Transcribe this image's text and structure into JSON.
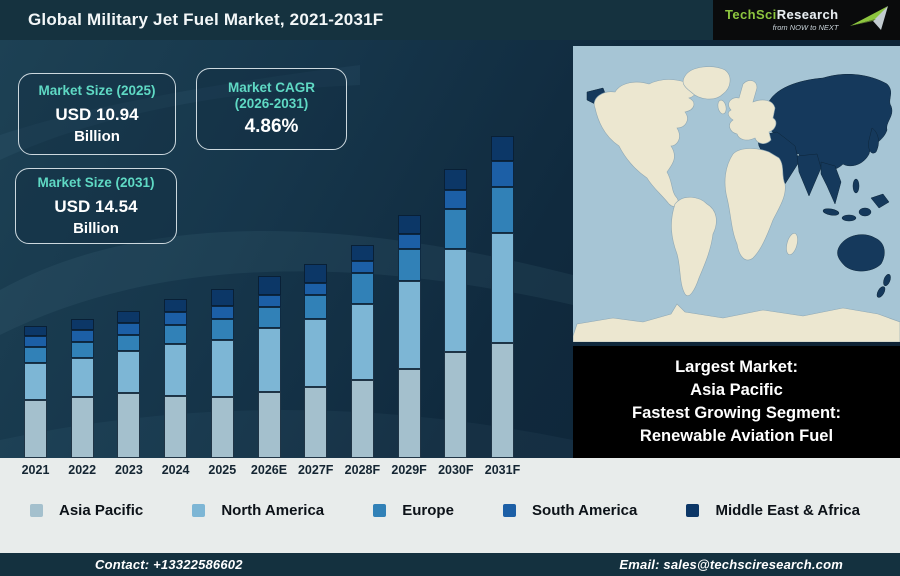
{
  "header": {
    "title": "Global Military Jet Fuel Market, 2021-2031F"
  },
  "logo": {
    "brand_primary": "TechSci",
    "brand_secondary": "Research",
    "tagline": "from NOW to NEXT"
  },
  "stats": [
    {
      "label": "Market Size (2025)",
      "label2": "",
      "value": "USD 10.94",
      "unit": "Billion"
    },
    {
      "label": "Market CAGR",
      "label2": "(2026-2031)",
      "value": "4.86%",
      "unit": ""
    },
    {
      "label": "Market Size (2031)",
      "label2": "",
      "value": "USD 14.54",
      "unit": "Billion"
    }
  ],
  "info_box": {
    "lines": [
      "Largest Market:",
      "Asia Pacific",
      "Fastest Growing Segment:",
      "Renewable Aviation Fuel"
    ]
  },
  "chart_data": {
    "type": "bar",
    "stacked": true,
    "title": "Global Military Jet Fuel Market, 2021-2031F",
    "xlabel": "",
    "ylabel": "",
    "axis_shown": false,
    "legend_position": "bottom",
    "unit_note": "relative bar heights (infographic shows no y-axis); market size labels: USD 10.94B in 2025, USD 14.54B in 2031, CAGR 4.86% (2026-2031)",
    "categories": [
      "2021",
      "2022",
      "2023",
      "2024",
      "2025",
      "2026E",
      "2027F",
      "2028F",
      "2029F",
      "2030F",
      "2031F"
    ],
    "series": [
      {
        "name": "Asia Pacific",
        "color": "#a4c0cd",
        "values": [
          58,
          61,
          65,
          62,
          61,
          66,
          71,
          78,
          89,
          106,
          115
        ]
      },
      {
        "name": "North America",
        "color": "#7db6d5",
        "values": [
          37,
          39,
          42,
          52,
          57,
          64,
          68,
          76,
          88,
          103,
          110
        ]
      },
      {
        "name": "Europe",
        "color": "#3181b7",
        "values": [
          16,
          16,
          16,
          19,
          21,
          21,
          24,
          31,
          32,
          40,
          46
        ]
      },
      {
        "name": "South America",
        "color": "#1c5fa6",
        "values": [
          11,
          12,
          12,
          13,
          13,
          12,
          12,
          12,
          15,
          19,
          26
        ]
      },
      {
        "name": "Middle East & Africa",
        "color": "#0c3767",
        "values": [
          10,
          11,
          12,
          13,
          17,
          19,
          19,
          16,
          19,
          21,
          25
        ]
      }
    ]
  },
  "map": {
    "highlighted_region": "Asia Pacific"
  },
  "footer": {
    "contact": "Contact: +13322586602",
    "email": "Email: sales@techsciresearch.com"
  },
  "colors": {
    "header_bg": "#15323f",
    "footer_bg": "#14313f",
    "strip_bg": "#e8eceb",
    "accent_teal": "#5fd9c4",
    "brand_green": "#8dc63f",
    "map_ocean": "#a6c5d5",
    "map_land": "#ece7d0",
    "map_highlight": "#15395c"
  }
}
